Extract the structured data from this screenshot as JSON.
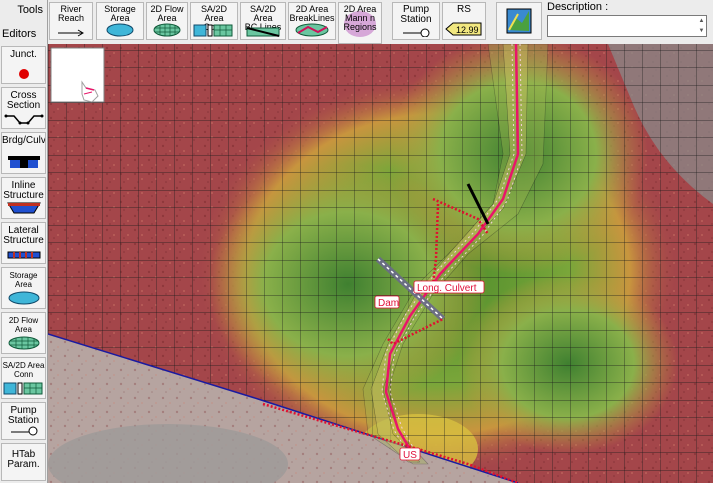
{
  "toolbar": {
    "tools_label": "Tools",
    "editors_label": "Editors",
    "buttons": [
      {
        "label": "River\nReach"
      },
      {
        "label": "Storage\nArea"
      },
      {
        "label": "2D Flow\nArea"
      },
      {
        "label": "SA/2D Area\nConn"
      },
      {
        "label": "SA/2D Area\nBC Lines"
      },
      {
        "label": "2D Area\nBreakLines"
      },
      {
        "label": "2D Area\nMann n\nRegions"
      },
      {
        "label": "Pump\nStation"
      },
      {
        "label": "RS",
        "value": "12.99"
      }
    ],
    "description_label": "Description :",
    "description_value": ""
  },
  "sidebar": {
    "items": [
      {
        "label": "Junct."
      },
      {
        "label": "Cross\nSection"
      },
      {
        "label": "Brdg/Culv"
      },
      {
        "label": "Inline\nStructure"
      },
      {
        "label": "Lateral\nStructure"
      },
      {
        "label": "Storage\nArea"
      },
      {
        "label": "2D Flow\nArea"
      },
      {
        "label": "SA/2D Area\nConn"
      },
      {
        "label": "Pump\nStation"
      },
      {
        "label": "HTab\nParam."
      }
    ]
  },
  "map": {
    "labels": {
      "dam": "Dam",
      "culvert": "Long. Culvert",
      "us": "US"
    },
    "colors": {
      "terrain_high": "#a8484a",
      "terrain_mid": "#c9933e",
      "terrain_low": "#4f8c2c",
      "grid": "#1a1a1a",
      "river": "#e8156a",
      "bc_line": "#e0103a",
      "perimeter": "#1a1aa0"
    }
  }
}
